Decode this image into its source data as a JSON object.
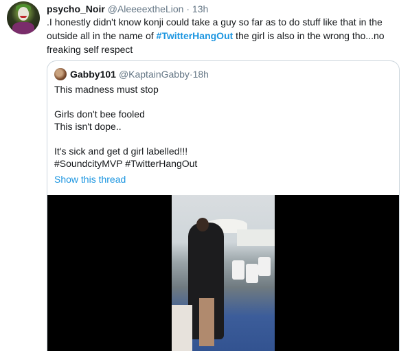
{
  "tweet": {
    "author_name": "psycho_Noir",
    "author_handle": "@AleeeextheLion",
    "separator": "·",
    "time": "13h",
    "text_before": ".I honestly didn't know konji could take a guy so far as to do stuff like that in the outside all in the name of ",
    "hashtag": "#TwitterHangOut",
    "text_after": " the girl is also in the wrong tho...no freaking self respect"
  },
  "quoted": {
    "author_name": "Gabby101",
    "author_handle": "@KaptainGabby",
    "separator": "·",
    "time": "18h",
    "lines": [
      "This madness must stop",
      "",
      "Girls don't bee fooled",
      "This isn't dope..",
      "",
      "It's sick and get d girl labelled!!!"
    ],
    "hashtags": "#SoundcityMVP #TwitterHangOut",
    "show_thread": "Show this thread"
  },
  "icons": {
    "avatar": "joker-avatar",
    "quoted_avatar": "user-avatar"
  },
  "colors": {
    "link": "#1b95e0",
    "secondary_text": "#657786",
    "border": "#ccd6dd"
  }
}
